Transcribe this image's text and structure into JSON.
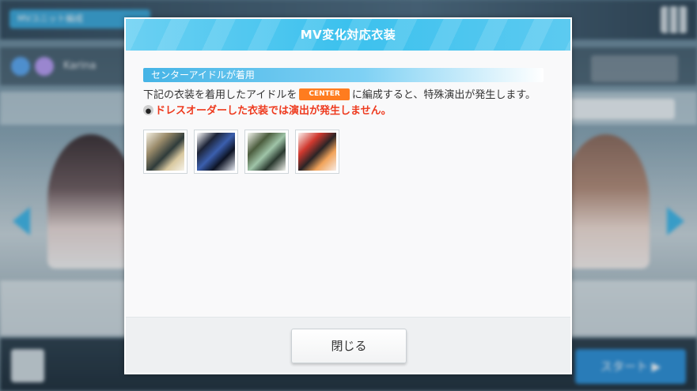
{
  "background": {
    "unit_tag": "MVユニット編成",
    "user_name": "Karina",
    "start_button": "スタート ▶"
  },
  "modal": {
    "title": "MV変化対応衣装",
    "section_label": "センターアイドルが着用",
    "desc_before": "下記の衣装を着用したアイドルを",
    "center_badge": "CENTER",
    "desc_after": "に編成すると、特殊演出が発生します。",
    "warning": "ドレスオーダーした衣装では演出が発生しません。",
    "costume_count": 4,
    "close_button": "閉じる"
  },
  "colors": {
    "header": "#3cc1ee",
    "center_badge": "#ff7c1f",
    "warning": "#ee3a1e"
  }
}
